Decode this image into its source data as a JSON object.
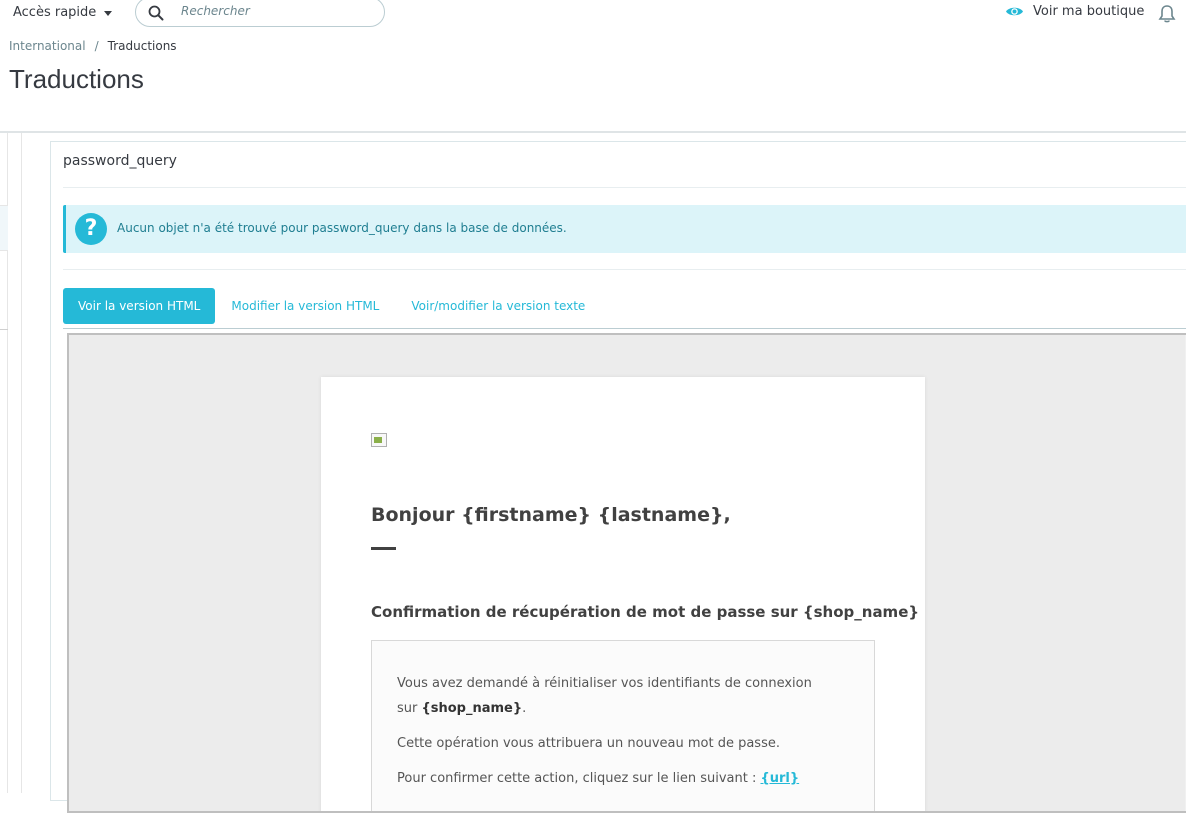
{
  "topbar": {
    "quick_access": "Accès rapide",
    "search_placeholder": "Rechercher",
    "shop_link": "Voir ma boutique"
  },
  "breadcrumb": [
    "International",
    "/",
    "Traductions"
  ],
  "page_title": "Traductions",
  "panel": {
    "title": "password_query",
    "alert": "Aucun objet n'a été trouvé pour password_query dans la base de données.",
    "tabs": [
      "Voir la version HTML",
      "Modifier la version HTML",
      "Voir/modifier la version texte"
    ]
  },
  "email": {
    "greeting": "Bonjour {firstname} {lastname},",
    "subtitle": "Confirmation de récupération de mot de passe sur {shop_name}",
    "line1_prefix": "Vous avez demandé à réinitialiser vos identifiants de connexion",
    "line1_sur": "sur ",
    "line1_shop": "{shop_name}",
    "line1_end": ".",
    "line2": "Cette opération vous attribuera un nouveau mot de passe.",
    "line3_prefix": "Pour confirmer cette action, cliquez sur le lien suivant : ",
    "line3_link": "{url}"
  },
  "colors": {
    "accent": "#25b9d7",
    "alert_bg": "#dcf4f9",
    "text": "#363a41"
  }
}
